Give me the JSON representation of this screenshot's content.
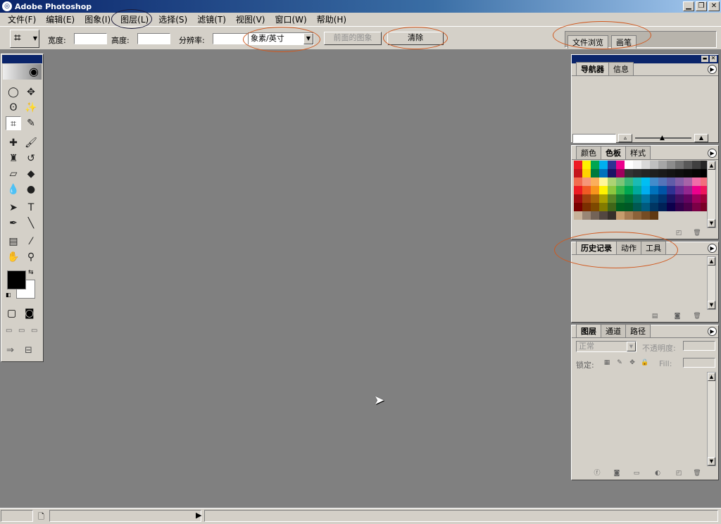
{
  "window": {
    "title": "Adobe Photoshop"
  },
  "menu": [
    "文件(F)",
    "编辑(E)",
    "图象(I)",
    "图层(L)",
    "选择(S)",
    "滤镜(T)",
    "视图(V)",
    "窗口(W)",
    "帮助(H)"
  ],
  "options": {
    "width_label": "宽度:",
    "height_label": "高度:",
    "resolution_label": "分辨率:",
    "unit_value": "象素/英寸",
    "front_image_label": "前面的图象",
    "clear_label": "清除",
    "file_browser_tab": "文件浏览",
    "brushes_tab": "画笔"
  },
  "navigator": {
    "tabs": [
      "导航器",
      "信息"
    ]
  },
  "color": {
    "tabs": [
      "颜色",
      "色板",
      "样式"
    ],
    "swatches": [
      "#ed1c24",
      "#fff200",
      "#00a651",
      "#00aeef",
      "#2e3192",
      "#ec008c",
      "#ffffff",
      "#f2f2f2",
      "#d9d9d9",
      "#bfbfbf",
      "#a6a6a6",
      "#8c8c8c",
      "#737373",
      "#595959",
      "#404040",
      "#262626",
      "#c4161c",
      "#ffd200",
      "#007a3d",
      "#0072bc",
      "#1b1464",
      "#9e005d",
      "#333333",
      "#2b2b2b",
      "#242424",
      "#1f1f1f",
      "#1a1a1a",
      "#141414",
      "#0f0f0f",
      "#0a0a0a",
      "#050505",
      "#000000",
      "#f26c4f",
      "#f69679",
      "#fbaf5c",
      "#fff799",
      "#acd373",
      "#7cc576",
      "#3bb878",
      "#1abbb4",
      "#00bff3",
      "#438ccb",
      "#5574b9",
      "#605ca8",
      "#855fa8",
      "#a763a8",
      "#f06ea9",
      "#f26d7d",
      "#ed1c24",
      "#f15a24",
      "#f7941d",
      "#fff200",
      "#8dc63f",
      "#39b54a",
      "#00a651",
      "#00a99d",
      "#00aeef",
      "#0072bc",
      "#0054a6",
      "#2e3192",
      "#662d91",
      "#92278f",
      "#ec008c",
      "#ed145b",
      "#9e0b0f",
      "#a0410d",
      "#a36209",
      "#aba000",
      "#598527",
      "#1a7b30",
      "#007236",
      "#00746b",
      "#0076a3",
      "#004b80",
      "#003471",
      "#1b1464",
      "#440e62",
      "#630460",
      "#9e005d",
      "#9e0039",
      "#790000",
      "#7b2e00",
      "#7d4900",
      "#827b00",
      "#406618",
      "#005e20",
      "#005826",
      "#005952",
      "#005b7f",
      "#003663",
      "#002157",
      "#0d004c",
      "#32004b",
      "#4b0049",
      "#7b0046",
      "#7a0026",
      "#c7b299",
      "#998675",
      "#736357",
      "#534741",
      "#37302a",
      "#c69c6d",
      "#a67c52",
      "#8c6239",
      "#754c24",
      "#603913"
    ]
  },
  "history": {
    "tabs": [
      "历史记录",
      "动作",
      "工具"
    ]
  },
  "layers": {
    "tabs": [
      "图层",
      "通道",
      "路径"
    ],
    "blend_mode": "正常",
    "opacity_label": "不透明度:",
    "lock_label": "锁定:",
    "fill_label": "Fill:"
  },
  "toolbox": {
    "tools": [
      {
        "name": "marquee-tool",
        "glyph": "◯"
      },
      {
        "name": "move-tool",
        "glyph": "✥"
      },
      {
        "name": "lasso-tool",
        "glyph": "ʘ"
      },
      {
        "name": "magic-wand-tool",
        "glyph": "✨"
      },
      {
        "name": "crop-tool",
        "glyph": "⌗"
      },
      {
        "name": "slice-tool",
        "glyph": "✎"
      },
      {
        "name": "healing-brush-tool",
        "glyph": "✚"
      },
      {
        "name": "brush-tool",
        "glyph": "🖌"
      },
      {
        "name": "clone-stamp-tool",
        "glyph": "♜"
      },
      {
        "name": "history-brush-tool",
        "glyph": "↺"
      },
      {
        "name": "eraser-tool",
        "glyph": "▱"
      },
      {
        "name": "paint-bucket-tool",
        "glyph": "◆"
      },
      {
        "name": "blur-tool",
        "glyph": "💧"
      },
      {
        "name": "dodge-tool",
        "glyph": "●"
      },
      {
        "name": "path-selection-tool",
        "glyph": "➤"
      },
      {
        "name": "type-tool",
        "glyph": "T"
      },
      {
        "name": "pen-tool",
        "glyph": "✒"
      },
      {
        "name": "line-tool",
        "glyph": "╲"
      },
      {
        "name": "notes-tool",
        "glyph": "▤"
      },
      {
        "name": "eyedropper-tool",
        "glyph": "⁄"
      },
      {
        "name": "hand-tool",
        "glyph": "✋"
      },
      {
        "name": "zoom-tool",
        "glyph": "⚲"
      }
    ]
  }
}
